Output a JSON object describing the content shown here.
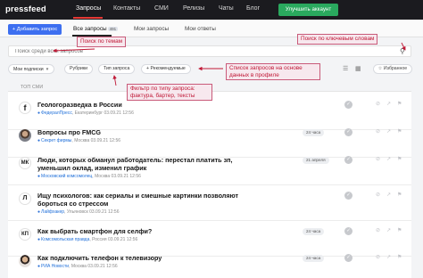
{
  "app": {
    "logo": "pressfeed"
  },
  "topnav": {
    "items": [
      "Запросы",
      "Контакты",
      "СМИ",
      "Релизы",
      "Чаты",
      "Блог"
    ],
    "upgrade_label": "Улучшить аккаунт"
  },
  "subnav": {
    "add_label": "+ Добавить запрос",
    "tabs": [
      {
        "label": "Все запросы",
        "count": "491"
      },
      {
        "label": "Мои запросы",
        "count": ""
      },
      {
        "label": "Мои ответы",
        "count": ""
      }
    ]
  },
  "search": {
    "placeholder": "Поиск среди всех запросов"
  },
  "filters": {
    "my_subscriptions": "Мои подписки",
    "rubrics": "Рубрики",
    "request_type": "Тип запроса",
    "recommended": "Рекомендуемые",
    "favorites": "Избранное"
  },
  "section_label": "ТОП СМИ",
  "requests": [
    {
      "title": "Геологоразведка в России",
      "source": "ФедералПресс",
      "location": "Екатеринбург",
      "date": "03.09.21 12:56",
      "badge": "",
      "icon": "logo-f",
      "title_lines": 1
    },
    {
      "title": "Вопросы про FMCG",
      "source": "Секрет фирмы",
      "location": "Москва",
      "date": "03.09.21 12:56",
      "badge": "24 часа",
      "icon": "photo-1",
      "title_lines": 1
    },
    {
      "title": "Люди, которых обманул работодатель: перестал платить зп, уменьшил оклад, изменил график",
      "source": "Московский комсомолец",
      "location": "Москва",
      "date": "03.09.21 12:56",
      "badge": "21 апреля",
      "icon": "logo-mk",
      "title_lines": 2
    },
    {
      "title": "Ищу психологов: как сериалы и смешные картинки позволяют бороться со стрессом",
      "source": "Лайфхакер",
      "location": "Ульяновск",
      "date": "03.09.21 12:56",
      "badge": "",
      "icon": "logo-l",
      "title_lines": 2
    },
    {
      "title": "Как выбрать смартфон для селфи?",
      "source": "Комсомольская правда",
      "location": "Россия",
      "date": "03.09.21 12:56",
      "badge": "24 часа",
      "icon": "logo-kp",
      "title_lines": 1
    },
    {
      "title": "Как подключить телефон к телевизору",
      "source": "РИА Новости",
      "location": "Москва",
      "date": "03.09.21 12:56",
      "badge": "24 часа",
      "icon": "photo-2",
      "title_lines": 1
    }
  ],
  "annotations": {
    "topics": "Поиск по темам",
    "keywords": "Поиск по ключевым словам",
    "profile_list": "Список запросов на основе данных в профиле",
    "type_filter": "Фильтр по типу запроса: фактура, бартер, тексты"
  },
  "colors": {
    "nav_bg": "#1b1b1f",
    "accent_blue": "#3d6ff0",
    "upgrade_green": "#2aa95e",
    "annotation_red": "#c01836"
  }
}
